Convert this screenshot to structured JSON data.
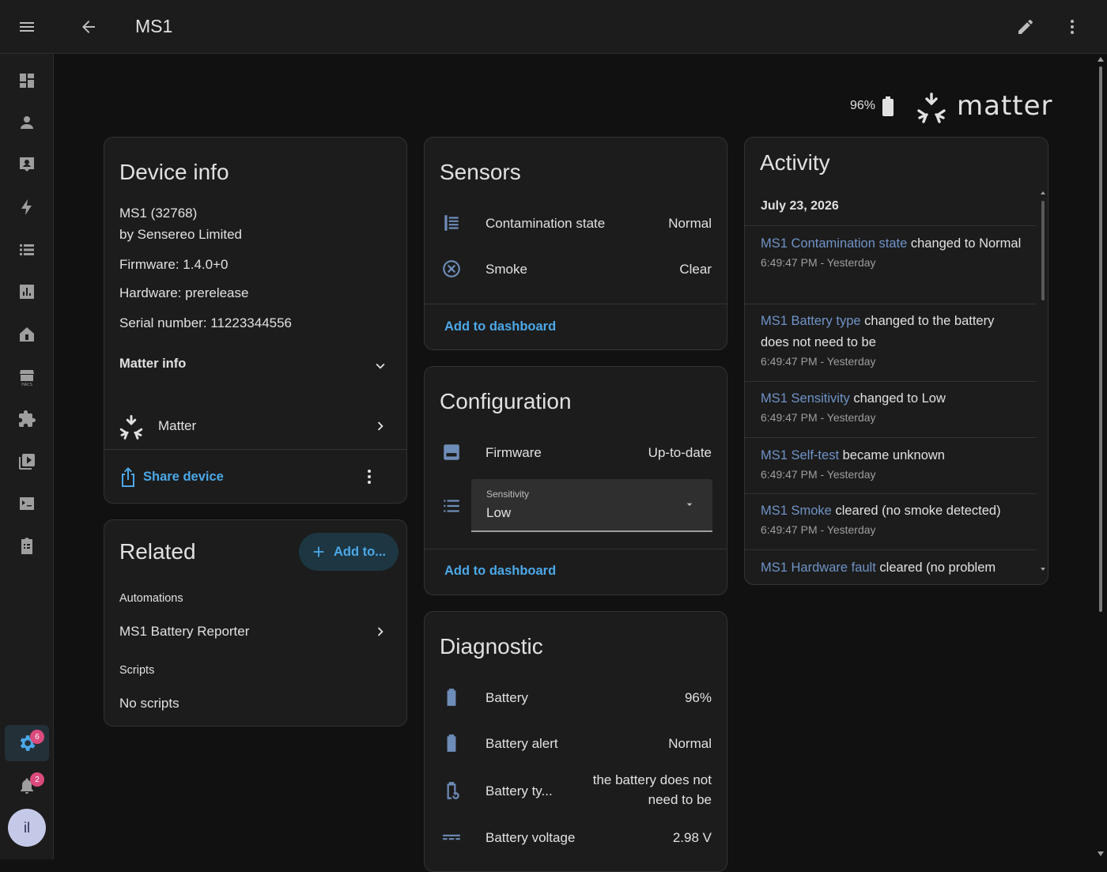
{
  "header": {
    "title": "MS1"
  },
  "top_right": {
    "battery": "96%"
  },
  "brand": {
    "name": "matter"
  },
  "sidebar": {
    "settings_badge": "6",
    "notifications_badge": "2",
    "avatar_initials": "il"
  },
  "device_info": {
    "title": "Device info",
    "model": "MS1 (32768)",
    "manufacturer": "by Sensereo Limited",
    "firmware": "Firmware: 1.4.0+0",
    "hardware": "Hardware: prerelease",
    "serial": "Serial number: 11223344556",
    "matter_info_label": "Matter info",
    "integration_label": "Matter",
    "share_label": "Share device"
  },
  "related": {
    "title": "Related",
    "add_label": "Add to...",
    "automations_header": "Automations",
    "automation_item": "MS1 Battery Reporter",
    "scripts_header": "Scripts",
    "scripts_empty": "No scripts"
  },
  "sensors": {
    "title": "Sensors",
    "rows": [
      {
        "label": "Contamination state",
        "value": "Normal"
      },
      {
        "label": "Smoke",
        "value": "Clear"
      }
    ],
    "add_label": "Add to dashboard"
  },
  "configuration": {
    "title": "Configuration",
    "firmware_label": "Firmware",
    "firmware_value": "Up-to-date",
    "select_label": "Sensitivity",
    "select_value": "Low",
    "add_label": "Add to dashboard"
  },
  "diagnostic": {
    "title": "Diagnostic",
    "rows": [
      {
        "label": "Battery",
        "value": "96%"
      },
      {
        "label": "Battery alert",
        "value": "Normal"
      },
      {
        "label": "Battery ty...",
        "value_line1": "the battery does not",
        "value_line2": "need to be"
      },
      {
        "label": "Battery voltage",
        "value": "2.98 V"
      }
    ]
  },
  "activity": {
    "title": "Activity",
    "date": "July 23, 2026",
    "entries": [
      {
        "entity": "MS1 Contamination state",
        "text": " changed to Normal",
        "time": "6:49:47 PM - Yesterday"
      },
      {
        "entity": "MS1 Battery type",
        "text": " changed to the battery does not need to be",
        "time": "6:49:47 PM - Yesterday"
      },
      {
        "entity": "MS1 Sensitivity",
        "text": " changed to Low",
        "time": "6:49:47 PM - Yesterday"
      },
      {
        "entity": "MS1 Self-test",
        "text": " became unknown",
        "time": "6:49:47 PM - Yesterday"
      },
      {
        "entity": "MS1 Smoke",
        "text": " cleared (no smoke detected)",
        "time": "6:49:47 PM - Yesterday"
      },
      {
        "entity": "MS1 Hardware fault",
        "text": " cleared (no problem",
        "time": ""
      }
    ]
  }
}
